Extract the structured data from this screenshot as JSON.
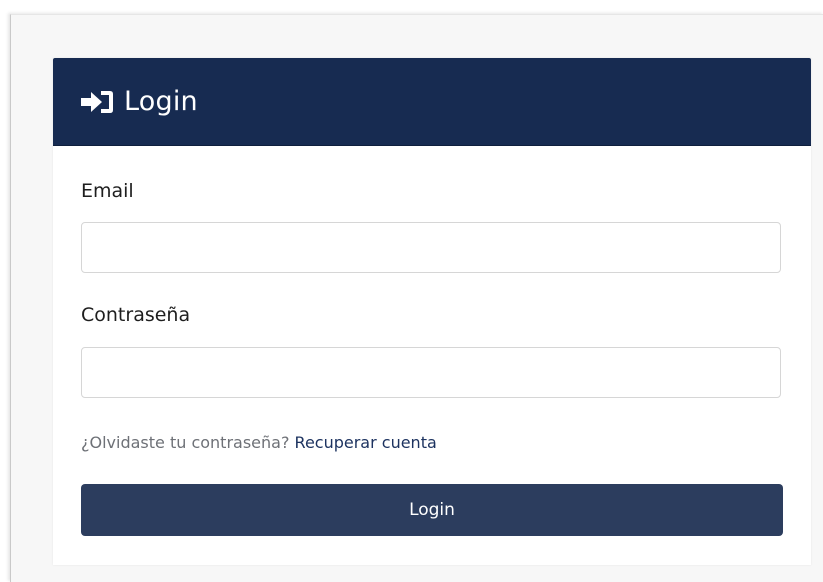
{
  "card": {
    "title": "Login",
    "header_color": "#172b51",
    "icon": "sign-in-icon"
  },
  "form": {
    "email_label": "Email",
    "email_value": "",
    "password_label": "Contraseña",
    "password_value": "",
    "forgot_text": "¿Olvidaste tu contraseña?",
    "recover_link": "Recuperar cuenta",
    "submit_label": "Login",
    "button_color": "#2c3d5e"
  }
}
